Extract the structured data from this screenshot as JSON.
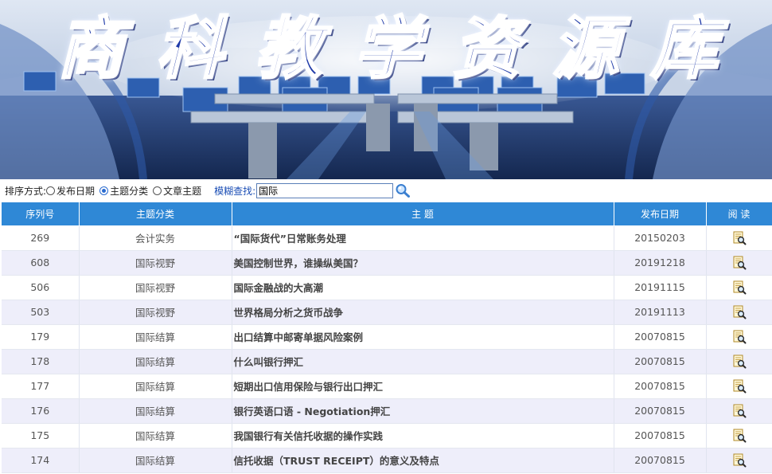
{
  "banner": {
    "title_chars": [
      "商",
      "科",
      "教",
      "学",
      "资",
      "源",
      "库"
    ]
  },
  "toolbar": {
    "sort_label": "排序方式:",
    "sort_options": [
      {
        "label": "发布日期",
        "selected": false
      },
      {
        "label": "主题分类",
        "selected": true
      },
      {
        "label": "文章主题",
        "selected": false
      }
    ],
    "fuzzy_label": "模糊查找:",
    "search_value": "国际"
  },
  "table": {
    "headers": [
      "序列号",
      "主题分类",
      "主 题",
      "发布日期",
      "阅 读"
    ],
    "rows": [
      {
        "id": "269",
        "category": "会计实务",
        "subject": "“国际货代”日常账务处理",
        "date": "20150203"
      },
      {
        "id": "608",
        "category": "国际视野",
        "subject": "美国控制世界，谁操纵美国？",
        "date": "20191218"
      },
      {
        "id": "506",
        "category": "国际视野",
        "subject": "国际金融战的大高潮",
        "date": "20191115"
      },
      {
        "id": "503",
        "category": "国际视野",
        "subject": "世界格局分析之货币战争",
        "date": "20191113"
      },
      {
        "id": "179",
        "category": "国际结算",
        "subject": "出口结算中邮寄单据风险案例",
        "date": "20070815"
      },
      {
        "id": "178",
        "category": "国际结算",
        "subject": "什么叫银行押汇",
        "date": "20070815"
      },
      {
        "id": "177",
        "category": "国际结算",
        "subject": "短期出口信用保险与银行出口押汇",
        "date": "20070815"
      },
      {
        "id": "176",
        "category": "国际结算",
        "subject": "银行英语口语 - Negotiation押汇",
        "date": "20070815"
      },
      {
        "id": "175",
        "category": "国际结算",
        "subject": "我国银行有关信托收据的操作实践",
        "date": "20070815"
      },
      {
        "id": "174",
        "category": "国际结算",
        "subject": "信托收据（TRUST RECEIPT）的意义及特点",
        "date": "20070815"
      }
    ]
  },
  "colors": {
    "header_bg": "#2f88d6",
    "row_alt_bg": "#eeeefa",
    "title_blue": "#1f3aa8"
  }
}
